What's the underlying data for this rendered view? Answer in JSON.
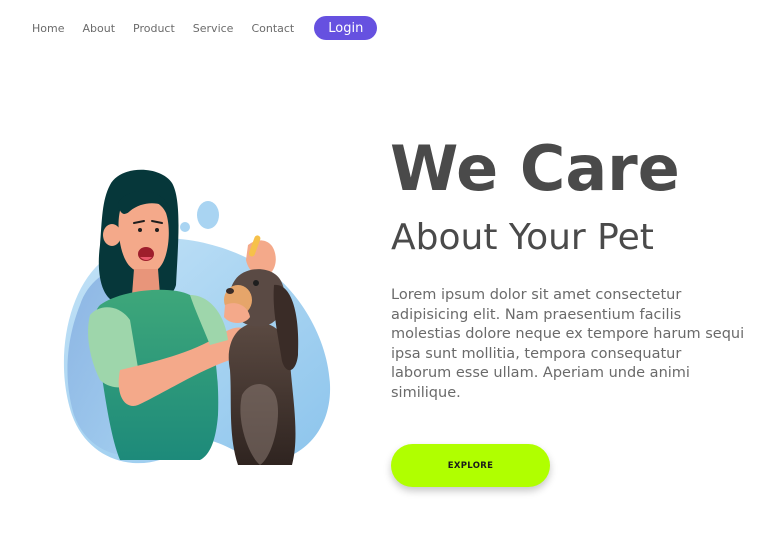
{
  "nav": {
    "items": [
      {
        "label": "Home"
      },
      {
        "label": "About"
      },
      {
        "label": "Product"
      },
      {
        "label": "Service"
      },
      {
        "label": "Contact"
      }
    ],
    "login_label": "Login"
  },
  "hero": {
    "title": "We Care",
    "subtitle": "About Your Pet",
    "body": "Lorem ipsum dolor sit amet consectetur adipisicing elit. Nam praesentium facilis molestias dolore neque ex tempore harum sequi ipsa sunt mollitia, tempora consequatur laborum esse ullam. Aperiam unde animi similique.",
    "cta_label": "EXPLORE"
  },
  "illustration": {
    "icon": "woman-giving-dog-eye-drops-illustration"
  },
  "colors": {
    "accent": "#6651e0",
    "cta": "#b0ff00",
    "heading": "#4a4a4a",
    "body_text": "#6a6a6a",
    "blob": "#a9d4f2"
  }
}
